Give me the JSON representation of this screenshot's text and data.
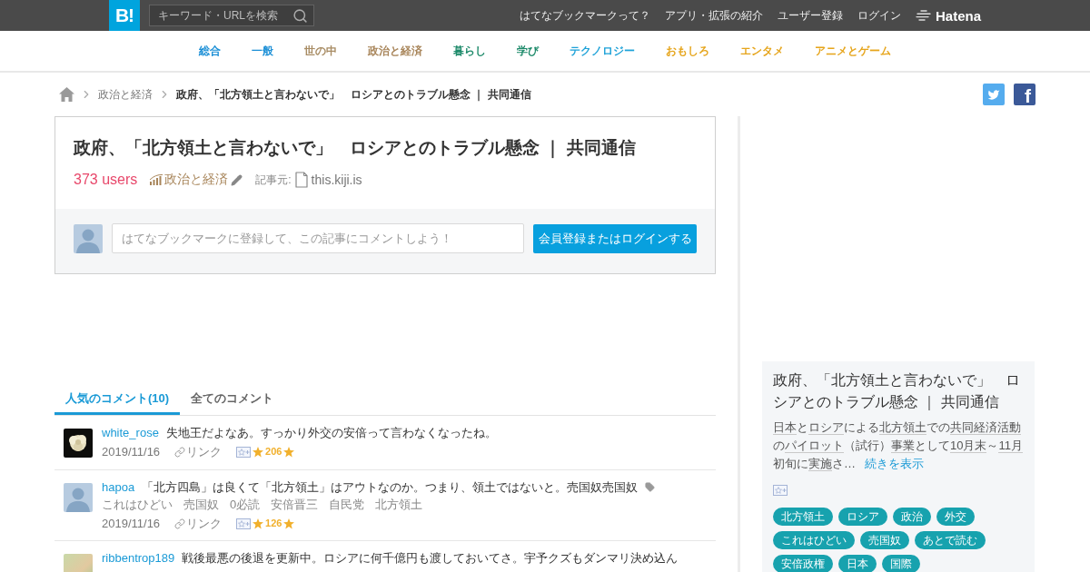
{
  "header": {
    "logo": "B!",
    "search": {
      "placeholder": "キーワード・URLを検索"
    },
    "links": [
      "はてなブックマークって？",
      "アプリ・拡張の紹介",
      "ユーザー登録",
      "ログイン"
    ],
    "brand": "Hatena"
  },
  "categories": [
    {
      "label": "総合",
      "color": "#1b8fd6"
    },
    {
      "label": "一般",
      "color": "#1b8fd6"
    },
    {
      "label": "世の中",
      "color": "#a88c64"
    },
    {
      "label": "政治と経済",
      "color": "#a8855a"
    },
    {
      "label": "暮らし",
      "color": "#1d8a6a"
    },
    {
      "label": "学び",
      "color": "#1d8a6a"
    },
    {
      "label": "テクノロジー",
      "color": "#1ea2d8"
    },
    {
      "label": "おもしろ",
      "color": "#e6a51c"
    },
    {
      "label": "エンタメ",
      "color": "#e6a51c"
    },
    {
      "label": "アニメとゲーム",
      "color": "#e6a51c"
    }
  ],
  "breadcrumb": [
    "政治と経済",
    "政府、「北方領土と言わないで」　ロシアとのトラブル懸念 ｜ 共同通信"
  ],
  "share": [
    {
      "kind": "bird"
    },
    {
      "kind": "letter",
      "label": "f"
    }
  ],
  "entry": {
    "title": "政府、「北方領土と言わないで」　ロシアとのトラブル懸念 ｜ 共同通信",
    "users": "373 users",
    "category": "政治と経済",
    "source_label": "記事元:",
    "source": "this.kiji.is",
    "comment_form": {
      "placeholder": "はてなブックマークに登録して、この記事にコメントしよう！",
      "button": "会員登録またはログインする"
    }
  },
  "comment_tabs": [
    {
      "label": "人気のコメント(10)",
      "selected": true
    },
    {
      "label": "全てのコメント",
      "selected": false
    }
  ],
  "comments": [
    {
      "avatar": {
        "kind": "flower"
      },
      "user": "white_rose",
      "text": "失地王だよなあ。すっかり外交の安倍って言わなくなったね。",
      "date": "2019/11/16",
      "link": "リンク",
      "star_count": "206"
    },
    {
      "avatar": {
        "kind": "default"
      },
      "user": "hapoa",
      "text": "「北方四島」は良くて「北方領土」はアウトなのか。つまり、領土ではないと。売国奴売国奴",
      "tags": [
        "これはひどい",
        "売国奴",
        "0必読",
        "安倍晋三",
        "自民党",
        "北方領土"
      ],
      "date": "2019/11/16",
      "link": "リンク",
      "star_count": "126"
    },
    {
      "avatar": {
        "kind": "photo"
      },
      "user": "ribbentrop189",
      "text": "戦後最悪の後退を更新中。ロシアに何千億円も渡しておいてさ。宇予クズもダンマリ決め込ん"
    }
  ],
  "sidebar": {
    "title": "政府、「北方領土と言わないで」　ロシアとのトラブル懸念 ｜ 共同通信",
    "description": [
      {
        "text": "日本",
        "keyword": true
      },
      {
        "text": "と",
        "keyword": false
      },
      {
        "text": "ロシア",
        "keyword": true
      },
      {
        "text": "による",
        "keyword": false
      },
      {
        "text": "北方領土",
        "keyword": true
      },
      {
        "text": "での",
        "keyword": false
      },
      {
        "text": "共同",
        "keyword": true
      },
      {
        "text": "経済活動",
        "keyword": true
      },
      {
        "text": "の",
        "keyword": false
      },
      {
        "text": "パイロット",
        "keyword": true
      },
      {
        "text": "（試行）",
        "keyword": false
      },
      {
        "text": "事業",
        "keyword": true
      },
      {
        "text": "として",
        "keyword": false
      },
      {
        "text": "10月末",
        "keyword": true
      },
      {
        "text": "～",
        "keyword": false
      },
      {
        "text": "11月",
        "keyword": true
      },
      {
        "text": "初旬に",
        "keyword": false
      },
      {
        "text": "実施",
        "keyword": true
      },
      {
        "text": "さ…",
        "keyword": false
      }
    ],
    "more": "続きを表示",
    "tags": [
      "北方領土",
      "ロシア",
      "政治",
      "外交",
      "これはひどい",
      "売国奴",
      "あとで読む",
      "安倍政権",
      "日本",
      "国際"
    ]
  }
}
